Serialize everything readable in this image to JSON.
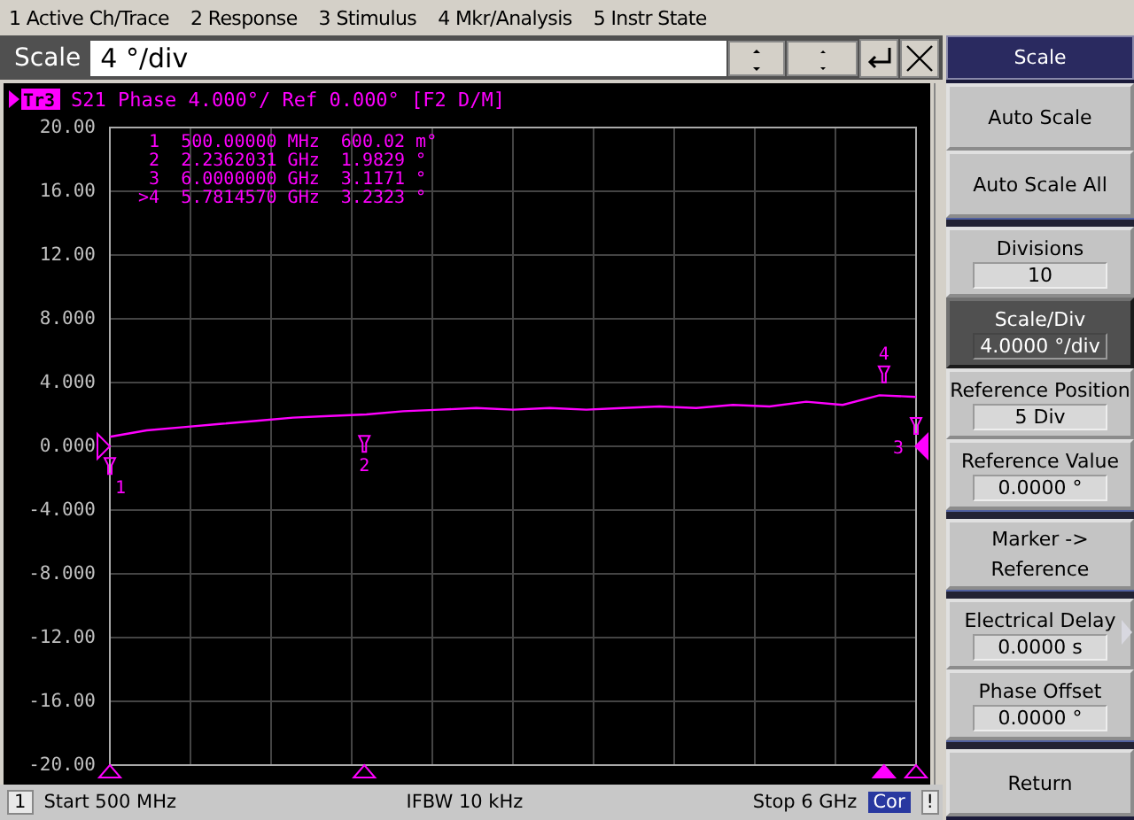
{
  "menu_bar": [
    "1 Active Ch/Trace",
    "2 Response",
    "3 Stimulus",
    "4 Mkr/Analysis",
    "5 Instr State"
  ],
  "entry_bar": {
    "label": "Scale",
    "value": "4 °/div"
  },
  "trace_header": {
    "tag": "Tr3",
    "text": "S21 Phase 4.000°/ Ref 0.000° [F2 D/M]"
  },
  "markers": [
    {
      "number": "1",
      "label": "1",
      "stimulus": "500.00000",
      "stimulus_unit": "MHz",
      "response": "600.02",
      "response_unit": "m°",
      "selected": false
    },
    {
      "number": "2",
      "label": "2",
      "stimulus": "2.2362031",
      "stimulus_unit": "GHz",
      "response": "1.9829",
      "response_unit": "°",
      "selected": false
    },
    {
      "number": "3",
      "label": "3",
      "stimulus": "6.0000000",
      "stimulus_unit": "GHz",
      "response": "3.1171",
      "response_unit": "°",
      "selected": false
    },
    {
      "number": ">4",
      "label": "4",
      "stimulus": "5.7814570",
      "stimulus_unit": "GHz",
      "response": "3.2323",
      "response_unit": "°",
      "selected": true
    }
  ],
  "chart_data": {
    "type": "line",
    "grid": true,
    "ylim": [
      -20,
      20
    ],
    "yticks": [
      {
        "value": 20,
        "label": "20.00"
      },
      {
        "value": 16,
        "label": "16.00"
      },
      {
        "value": 12,
        "label": "12.00"
      },
      {
        "value": 8,
        "label": "8.000"
      },
      {
        "value": 4,
        "label": "4.000"
      },
      {
        "value": 0,
        "label": "0.000"
      },
      {
        "value": -4,
        "label": "-4.000"
      },
      {
        "value": -8,
        "label": "-8.000"
      },
      {
        "value": -12,
        "label": "-12.00"
      },
      {
        "value": -16,
        "label": "-16.00"
      },
      {
        "value": -20,
        "label": "-20.00"
      }
    ],
    "categories": [
      null,
      null,
      null,
      null,
      null,
      null,
      null,
      null,
      null,
      null,
      null,
      null,
      null,
      null,
      null,
      null,
      null,
      null,
      null,
      null,
      null,
      null,
      null
    ],
    "series": [
      {
        "color": "#ff00ff",
        "values": [
          0.6,
          1.0,
          1.2,
          1.4,
          1.6,
          1.8,
          1.9,
          2.0,
          2.2,
          2.3,
          2.4,
          2.3,
          2.4,
          2.3,
          2.4,
          2.5,
          2.4,
          2.6,
          2.5,
          2.8,
          2.6,
          3.2,
          3.1
        ]
      }
    ]
  },
  "softkeys": [
    {
      "kind": "title",
      "label": "Scale"
    },
    {
      "kind": "button",
      "label": "Auto Scale"
    },
    {
      "kind": "button",
      "label": "Auto Scale All"
    },
    {
      "kind": "separator"
    },
    {
      "kind": "value",
      "label": "Divisions",
      "value": "10",
      "selected": false
    },
    {
      "kind": "value",
      "label": "Scale/Div",
      "value": "4.0000 °/div",
      "selected": true
    },
    {
      "kind": "value",
      "label": "Reference Position",
      "value": "5 Div",
      "selected": false
    },
    {
      "kind": "value",
      "label": "Reference Value",
      "value": "0.0000 °",
      "selected": false
    },
    {
      "kind": "separator"
    },
    {
      "kind": "button2",
      "label": "Marker ->",
      "label2": "Reference"
    },
    {
      "kind": "separator"
    },
    {
      "kind": "value",
      "label": "Electrical Delay",
      "value": "0.0000 s",
      "selected": false,
      "submenu": true
    },
    {
      "kind": "value",
      "label": "Phase Offset",
      "value": "0.0000 °",
      "selected": false
    },
    {
      "kind": "separator"
    },
    {
      "kind": "button",
      "label": "Return"
    }
  ],
  "status_bar": {
    "channel": "1",
    "start": "Start 500 MHz",
    "ifbw": "IFBW 10 kHz",
    "stop": "Stop 6 GHz",
    "correction": "Cor",
    "flag": "!"
  }
}
